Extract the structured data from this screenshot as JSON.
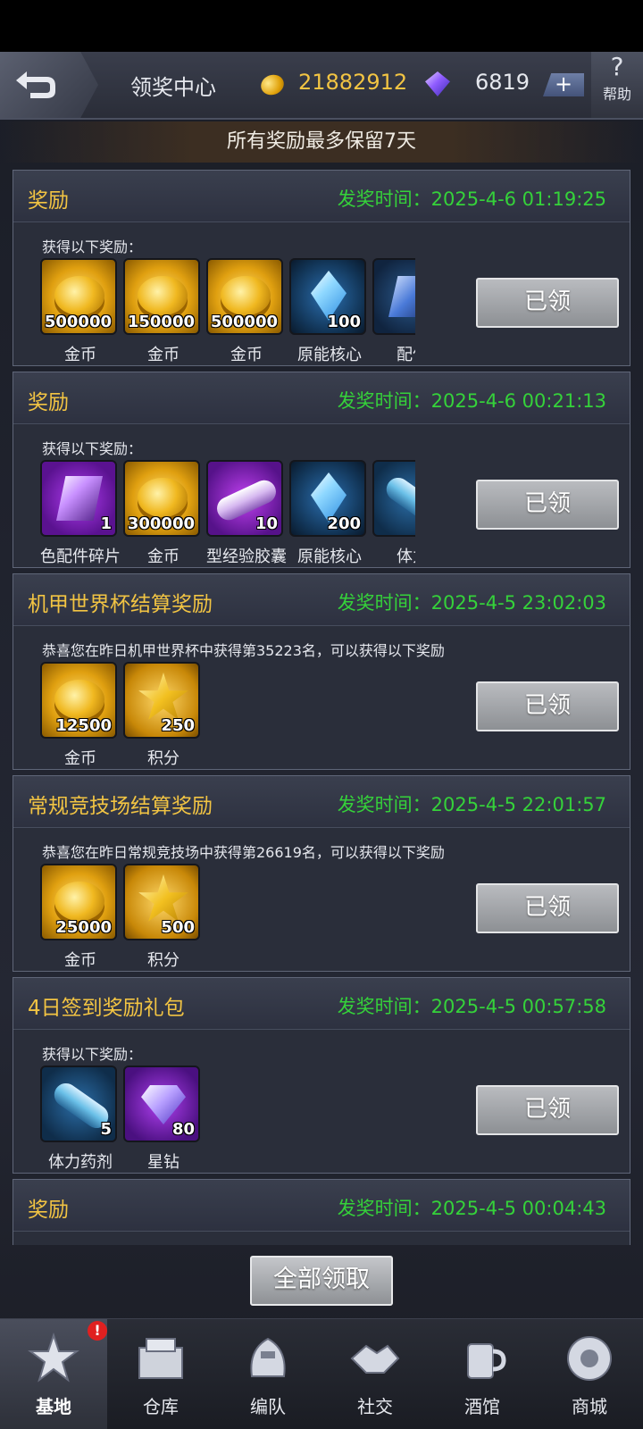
{
  "header": {
    "title": "领奖中心",
    "gold": "21882912",
    "gems": "6819",
    "plus": "+",
    "help_symbol": "?",
    "help_label": "帮助",
    "icons": {
      "back": "back-arrow-icon",
      "gold": "gold-coin-icon",
      "gem": "gem-icon"
    }
  },
  "notice": "所有奖励最多保留7天",
  "rewards": [
    {
      "title": "奖励",
      "time": "发奖时间：2025-4-6 01:19:25",
      "desc": "获得以下奖励：",
      "items": [
        {
          "name": "金币",
          "qty": "500000",
          "icon": "ic-gold"
        },
        {
          "name": "金币",
          "qty": "150000",
          "icon": "ic-gold"
        },
        {
          "name": "金币",
          "qty": "500000",
          "icon": "ic-gold"
        },
        {
          "name": "原能核心",
          "qty": "100",
          "icon": "ic-core"
        },
        {
          "name": "配件",
          "qty": "",
          "icon": "ic-part-blue"
        }
      ],
      "button": "已领"
    },
    {
      "title": "奖励",
      "time": "发奖时间：2025-4-6 00:21:13",
      "desc": "获得以下奖励：",
      "items": [
        {
          "name": "色配件碎片",
          "qty": "1",
          "icon": "ic-part-purple"
        },
        {
          "name": "金币",
          "qty": "300000",
          "icon": "ic-gold"
        },
        {
          "name": "型经验胶囊",
          "qty": "10",
          "icon": "ic-capsule"
        },
        {
          "name": "原能核心",
          "qty": "200",
          "icon": "ic-core"
        },
        {
          "name": "体力",
          "qty": "",
          "icon": "ic-stamina"
        }
      ],
      "button": "已领"
    },
    {
      "title": "机甲世界杯结算奖励",
      "time": "发奖时间：2025-4-5 23:02:03",
      "desc": "恭喜您在昨日机甲世界杯中获得第35223名，可以获得以下奖励",
      "items": [
        {
          "name": "金币",
          "qty": "12500",
          "icon": "ic-gold"
        },
        {
          "name": "积分",
          "qty": "250",
          "icon": "ic-star"
        }
      ],
      "button": "已领"
    },
    {
      "title": "常规竞技场结算奖励",
      "time": "发奖时间：2025-4-5 22:01:57",
      "desc": "恭喜您在昨日常规竞技场中获得第26619名，可以获得以下奖励",
      "items": [
        {
          "name": "金币",
          "qty": "25000",
          "icon": "ic-gold"
        },
        {
          "name": "积分",
          "qty": "500",
          "icon": "ic-star"
        }
      ],
      "button": "已领"
    },
    {
      "title": "4日签到奖励礼包",
      "time": "发奖时间：2025-4-5 00:57:58",
      "desc": "获得以下奖励：",
      "items": [
        {
          "name": "体力药剂",
          "qty": "5",
          "icon": "ic-stamina"
        },
        {
          "name": "星钻",
          "qty": "80",
          "icon": "ic-stardiamond"
        }
      ],
      "button": "已领"
    },
    {
      "title": "奖励",
      "time": "发奖时间：2025-4-5 00:04:43",
      "desc": "",
      "items": [],
      "button": ""
    }
  ],
  "claim_all": "全部领取",
  "nav": {
    "badge": "!",
    "items": [
      {
        "label": "基地",
        "icon": "base-icon",
        "active": true
      },
      {
        "label": "仓库",
        "icon": "warehouse-icon",
        "active": false
      },
      {
        "label": "编队",
        "icon": "formation-icon",
        "active": false
      },
      {
        "label": "社交",
        "icon": "social-icon",
        "active": false
      },
      {
        "label": "酒馆",
        "icon": "tavern-icon",
        "active": false
      },
      {
        "label": "商城",
        "icon": "shop-icon",
        "active": false
      }
    ]
  },
  "colors": {
    "title_gold": "#f2c443",
    "time_green": "#35d23a"
  }
}
